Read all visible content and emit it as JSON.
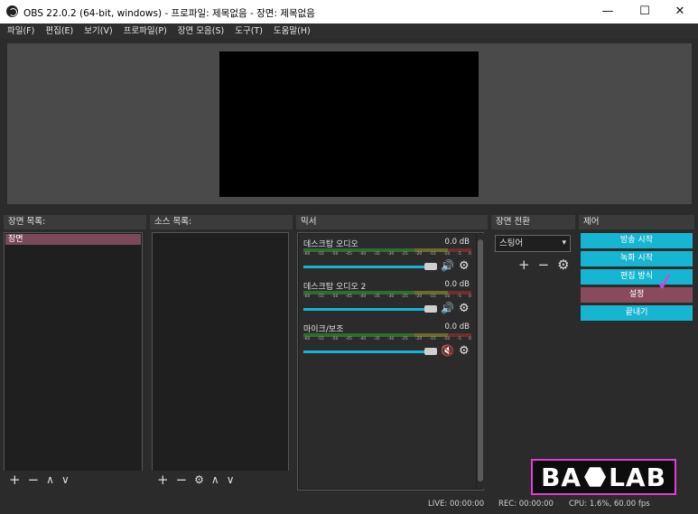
{
  "window": {
    "title": "OBS 22.0.2 (64-bit, windows) - 프로파일: 제목없음 - 장면: 제목없음",
    "minimize": "—",
    "maximize": "☐",
    "close": "✕"
  },
  "menu": [
    "파일(F)",
    "편집(E)",
    "보기(V)",
    "프로파일(P)",
    "장면 모음(S)",
    "도구(T)",
    "도움말(H)"
  ],
  "scenes": {
    "header": "장면 목록:",
    "items": [
      "장면"
    ],
    "toolbar": [
      "+",
      "−",
      "∧",
      "∨"
    ]
  },
  "sources": {
    "header": "소스 목록:",
    "toolbar": [
      "+",
      "−",
      "⚙",
      "∧",
      "∨"
    ]
  },
  "mixer": {
    "header": "믹서",
    "ticks": [
      "-60",
      "-55",
      "-50",
      "-45",
      "-40",
      "-35",
      "-30",
      "-25",
      "-20",
      "-15",
      "-10",
      "-5",
      "0"
    ],
    "tracks": [
      {
        "name": "데스크탑 오디오",
        "db": "0.0 dB",
        "muted": false
      },
      {
        "name": "데스크탑 오디오 2",
        "db": "0.0 dB",
        "muted": false
      },
      {
        "name": "마이크/보조",
        "db": "0.0 dB",
        "muted": true
      }
    ]
  },
  "transitions": {
    "header": "장면 전환",
    "selected": "스팅어",
    "toolbar": [
      "+",
      "−",
      "⚙"
    ]
  },
  "controls": {
    "header": "제어",
    "buttons": [
      "방송 시작",
      "녹화 시작",
      "편집 방식",
      "설정",
      "끝내기"
    ],
    "active_index": 3
  },
  "logo": {
    "text_left": "BA",
    "text_right": "LAB"
  },
  "status": {
    "live": "LIVE: 00:00:00",
    "rec": "REC: 00:00:00",
    "cpu": "CPU: 1.6%, 60.00 fps"
  },
  "colors": {
    "accent": "#16b5d2",
    "selected": "#8a4a5e",
    "annotation": "#e03cd6"
  }
}
